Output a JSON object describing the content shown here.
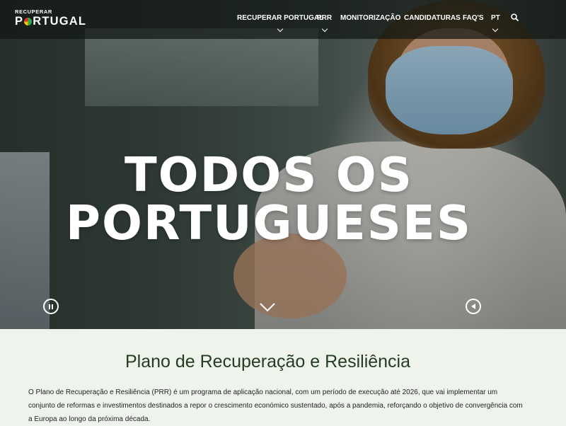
{
  "header": {
    "logo_top": "RECUPERAR",
    "logo_main_left": "P",
    "logo_main_right": "RTUGAL",
    "nav": [
      {
        "label": "RECUPERAR PORTUGAL",
        "dropdown": true
      },
      {
        "label": "PRR",
        "dropdown": true
      },
      {
        "label": "MONITORIZAÇÃO",
        "dropdown": false
      },
      {
        "label": "CANDIDATURAS",
        "dropdown": false
      },
      {
        "label": "FAQ'S",
        "dropdown": false
      },
      {
        "label": "PT",
        "dropdown": true
      }
    ],
    "search_icon": "search-icon"
  },
  "hero": {
    "line1": "TODOS OS",
    "line2": "PORTUGUESES",
    "controls": {
      "pause_icon": "pause-icon",
      "scroll_icon": "chevron-down-icon",
      "sound_icon": "speaker-icon"
    }
  },
  "section": {
    "title": "Plano de Recuperação e Resiliência",
    "text": "O Plano de Recuperação e Resiliência (PRR) é um programa de aplicação nacional, com um período de execução até 2026, que vai implementar um conjunto de reformas e  investimentos destinados a repor o crescimento económico sustentado, após a pandemia, reforçando o objetivo de convergência com a Europa ao longo da próxima década."
  },
  "colors": {
    "heading": "#243d22",
    "content_bg": "#eef4ec",
    "header_bg": "#121814"
  }
}
